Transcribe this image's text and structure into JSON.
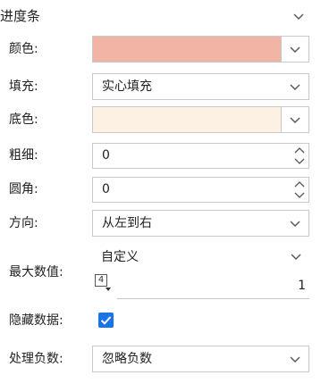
{
  "header": {
    "value": "进度条"
  },
  "fields": {
    "color": {
      "label": "颜色:",
      "swatch": "#f2b4a4"
    },
    "fill": {
      "label": "填充:",
      "value": "实心填充"
    },
    "base_color": {
      "label": "底色:",
      "swatch": "#fdf1e4"
    },
    "thickness": {
      "label": "粗细:",
      "value": "0"
    },
    "radius": {
      "label": "圆角:",
      "value": "0"
    },
    "direction": {
      "label": "方向:",
      "value": "从左到右"
    },
    "max_value": {
      "label": "最大数值:",
      "mode": "自定义",
      "number": "1",
      "icon_badge": "4"
    },
    "hide_data": {
      "label": "隐藏数据:",
      "checked": true
    },
    "negative": {
      "label": "处理负数:",
      "value": "忽略负数"
    }
  },
  "icons": {
    "dropdown": "chevron-down-icon",
    "stepper": "spin-up-down-icon",
    "check": "checkmark-icon"
  },
  "colors": {
    "accent": "#1a73e8",
    "border": "#c9c9c9"
  }
}
